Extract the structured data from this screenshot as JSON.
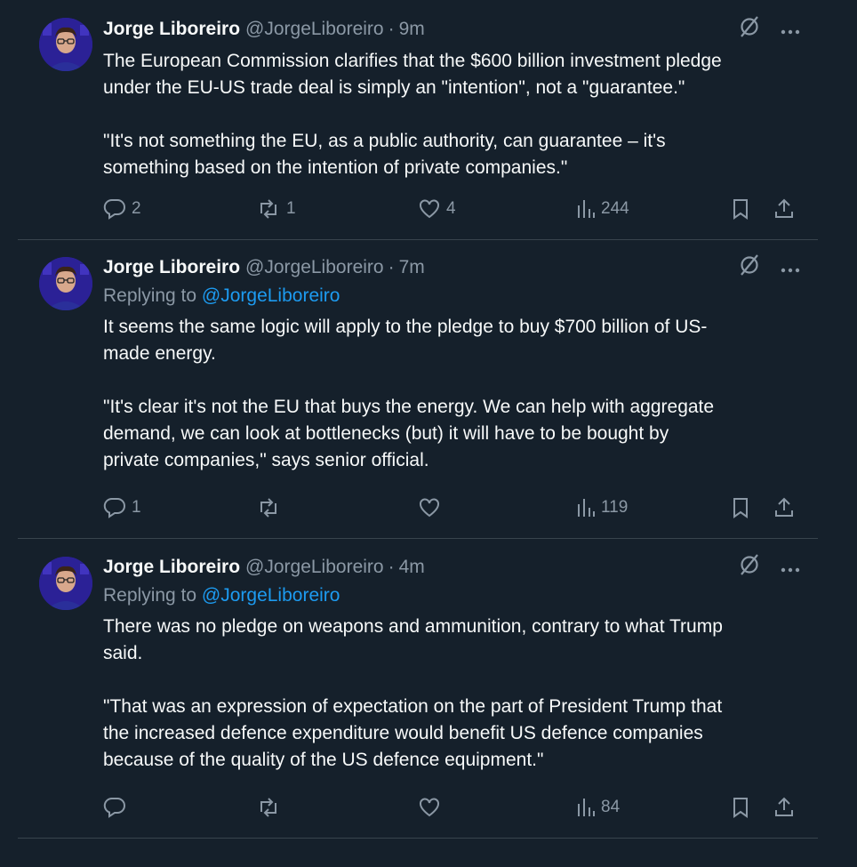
{
  "tweets": [
    {
      "name": "Jorge Liboreiro",
      "handle": "@JorgeLiboreiro",
      "separator": "·",
      "time": "9m",
      "replying_prefix": "",
      "replying_to": "",
      "text": "The European Commission clarifies that the $600 billion investment pledge\nunder the EU-US trade deal is simply an \"intention\", not a \"guarantee.\"\n\n\"It's not something the EU, as a public authority, can guarantee – it's\nsomething based on the intention of private companies.\"",
      "replies": "2",
      "reposts": "1",
      "likes": "4",
      "views": "244"
    },
    {
      "name": "Jorge Liboreiro",
      "handle": "@JorgeLiboreiro",
      "separator": "·",
      "time": "7m",
      "replying_prefix": "Replying to ",
      "replying_to": "@JorgeLiboreiro",
      "text": "It seems the same logic will apply to the pledge to buy $700 billion of US-\nmade energy.\n\n\"It's clear it's not the EU that buys the energy. We can help with aggregate\ndemand, we can look at bottlenecks (but) it will have to be bought by\nprivate companies,\" says senior official.",
      "replies": "1",
      "reposts": "",
      "likes": "",
      "views": "119"
    },
    {
      "name": "Jorge Liboreiro",
      "handle": "@JorgeLiboreiro",
      "separator": "·",
      "time": "4m",
      "replying_prefix": "Replying to ",
      "replying_to": "@JorgeLiboreiro",
      "text": "There was no pledge on weapons and ammunition, contrary to what Trump\nsaid.\n\n\"That was an expression of expectation on the part of President Trump that\nthe increased defence expenditure would benefit US defence companies\nbecause of the quality of the US defence equipment.\"",
      "replies": "",
      "reposts": "",
      "likes": "",
      "views": "84"
    }
  ],
  "icons": {
    "grok": "grok-icon",
    "more": "more-icon",
    "reply": "reply-icon",
    "repost": "repost-icon",
    "like": "like-icon",
    "views": "views-icon",
    "bookmark": "bookmark-icon",
    "share": "share-icon"
  },
  "colors": {
    "background": "#15202b",
    "text": "#f7f9f9",
    "secondary": "#8b98a5",
    "link": "#1d9bf0",
    "divider": "#38444d"
  }
}
